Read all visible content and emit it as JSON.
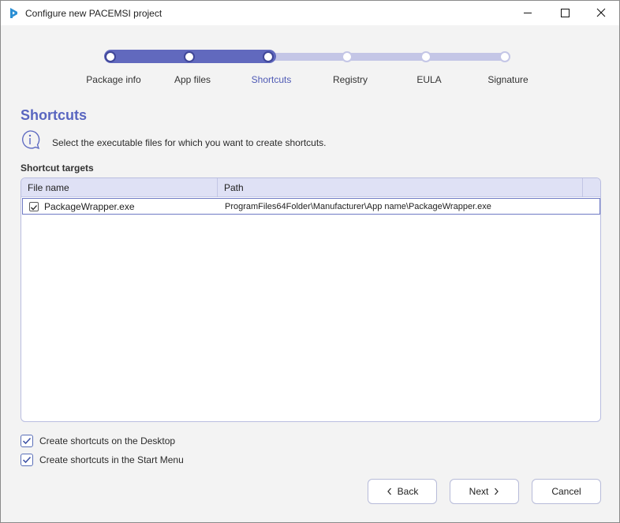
{
  "window": {
    "title": "Configure new PACEMSI project"
  },
  "stepper": {
    "steps": [
      {
        "label": "Package info",
        "state": "done"
      },
      {
        "label": "App files",
        "state": "done"
      },
      {
        "label": "Shortcuts",
        "state": "active"
      },
      {
        "label": "Registry",
        "state": "todo"
      },
      {
        "label": "EULA",
        "state": "todo"
      },
      {
        "label": "Signature",
        "state": "todo"
      }
    ]
  },
  "section": {
    "title": "Shortcuts",
    "info": "Select the executable files for which you want to create shortcuts."
  },
  "targets": {
    "label": "Shortcut targets",
    "columns": [
      "File name",
      "Path"
    ],
    "rows": [
      {
        "checked": true,
        "file_name": "PackageWrapper.exe",
        "path": "ProgramFiles64Folder\\Manufacturer\\App name\\PackageWrapper.exe"
      }
    ]
  },
  "options": {
    "desktop": {
      "label": "Create shortcuts on the Desktop",
      "checked": true
    },
    "start_menu": {
      "label": "Create shortcuts in the Start Menu",
      "checked": true
    }
  },
  "buttons": {
    "back": "Back",
    "next": "Next",
    "cancel": "Cancel"
  },
  "colors": {
    "accent": "#5966c0",
    "progress_fill": "#6169be",
    "progress_track": "#c4c6e6",
    "header_bg": "#dfe1f5"
  },
  "icons": {
    "app": "pacemsi-logo-icon",
    "info": "info-icon",
    "check": "checkmark-icon",
    "back": "chevron-left-icon",
    "next": "chevron-right-icon"
  }
}
